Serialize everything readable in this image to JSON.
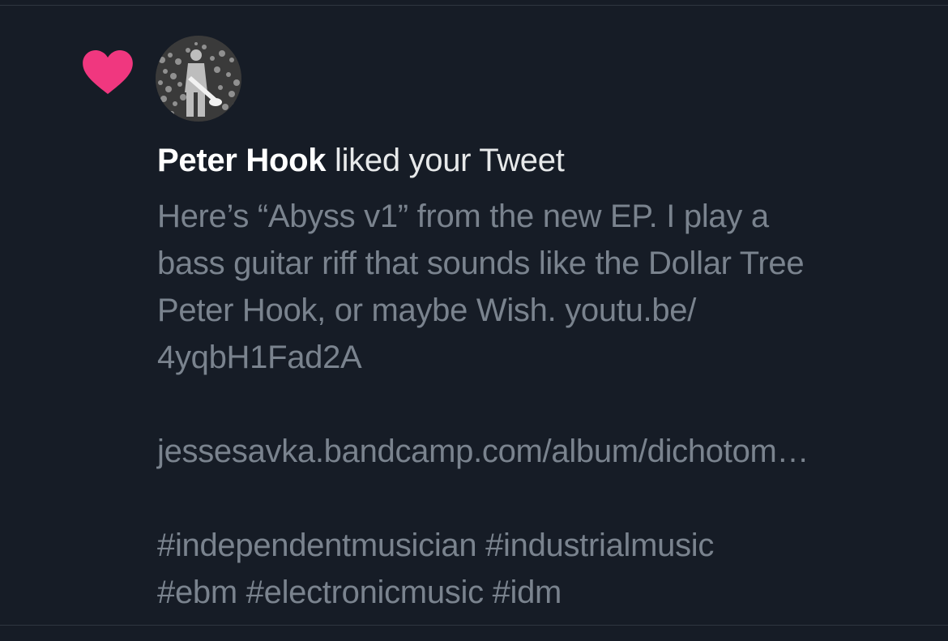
{
  "notification": {
    "type_icon": "heart-icon",
    "accent_color": "#f0377f",
    "user_name": "Peter Hook",
    "action_text": " liked your Tweet",
    "tweet": {
      "line1": "Here’s “Abyss v1” from the new EP. I play a",
      "line2": "bass guitar riff that sounds like the Dollar Tree",
      "line3": "Peter Hook, or maybe Wish. youtu.be/",
      "line4": "4yqbH1Fad2A",
      "link": "jessesavka.bandcamp.com/album/dichotom…",
      "hashtags_line1": "#independentmusician #industrialmusic",
      "hashtags_line2": "#ebm #electronicmusic #idm"
    }
  },
  "colors": {
    "background": "#161c26",
    "primary_text": "#e7e9ea",
    "secondary_text": "#7a838e",
    "divider": "#2f3640"
  }
}
